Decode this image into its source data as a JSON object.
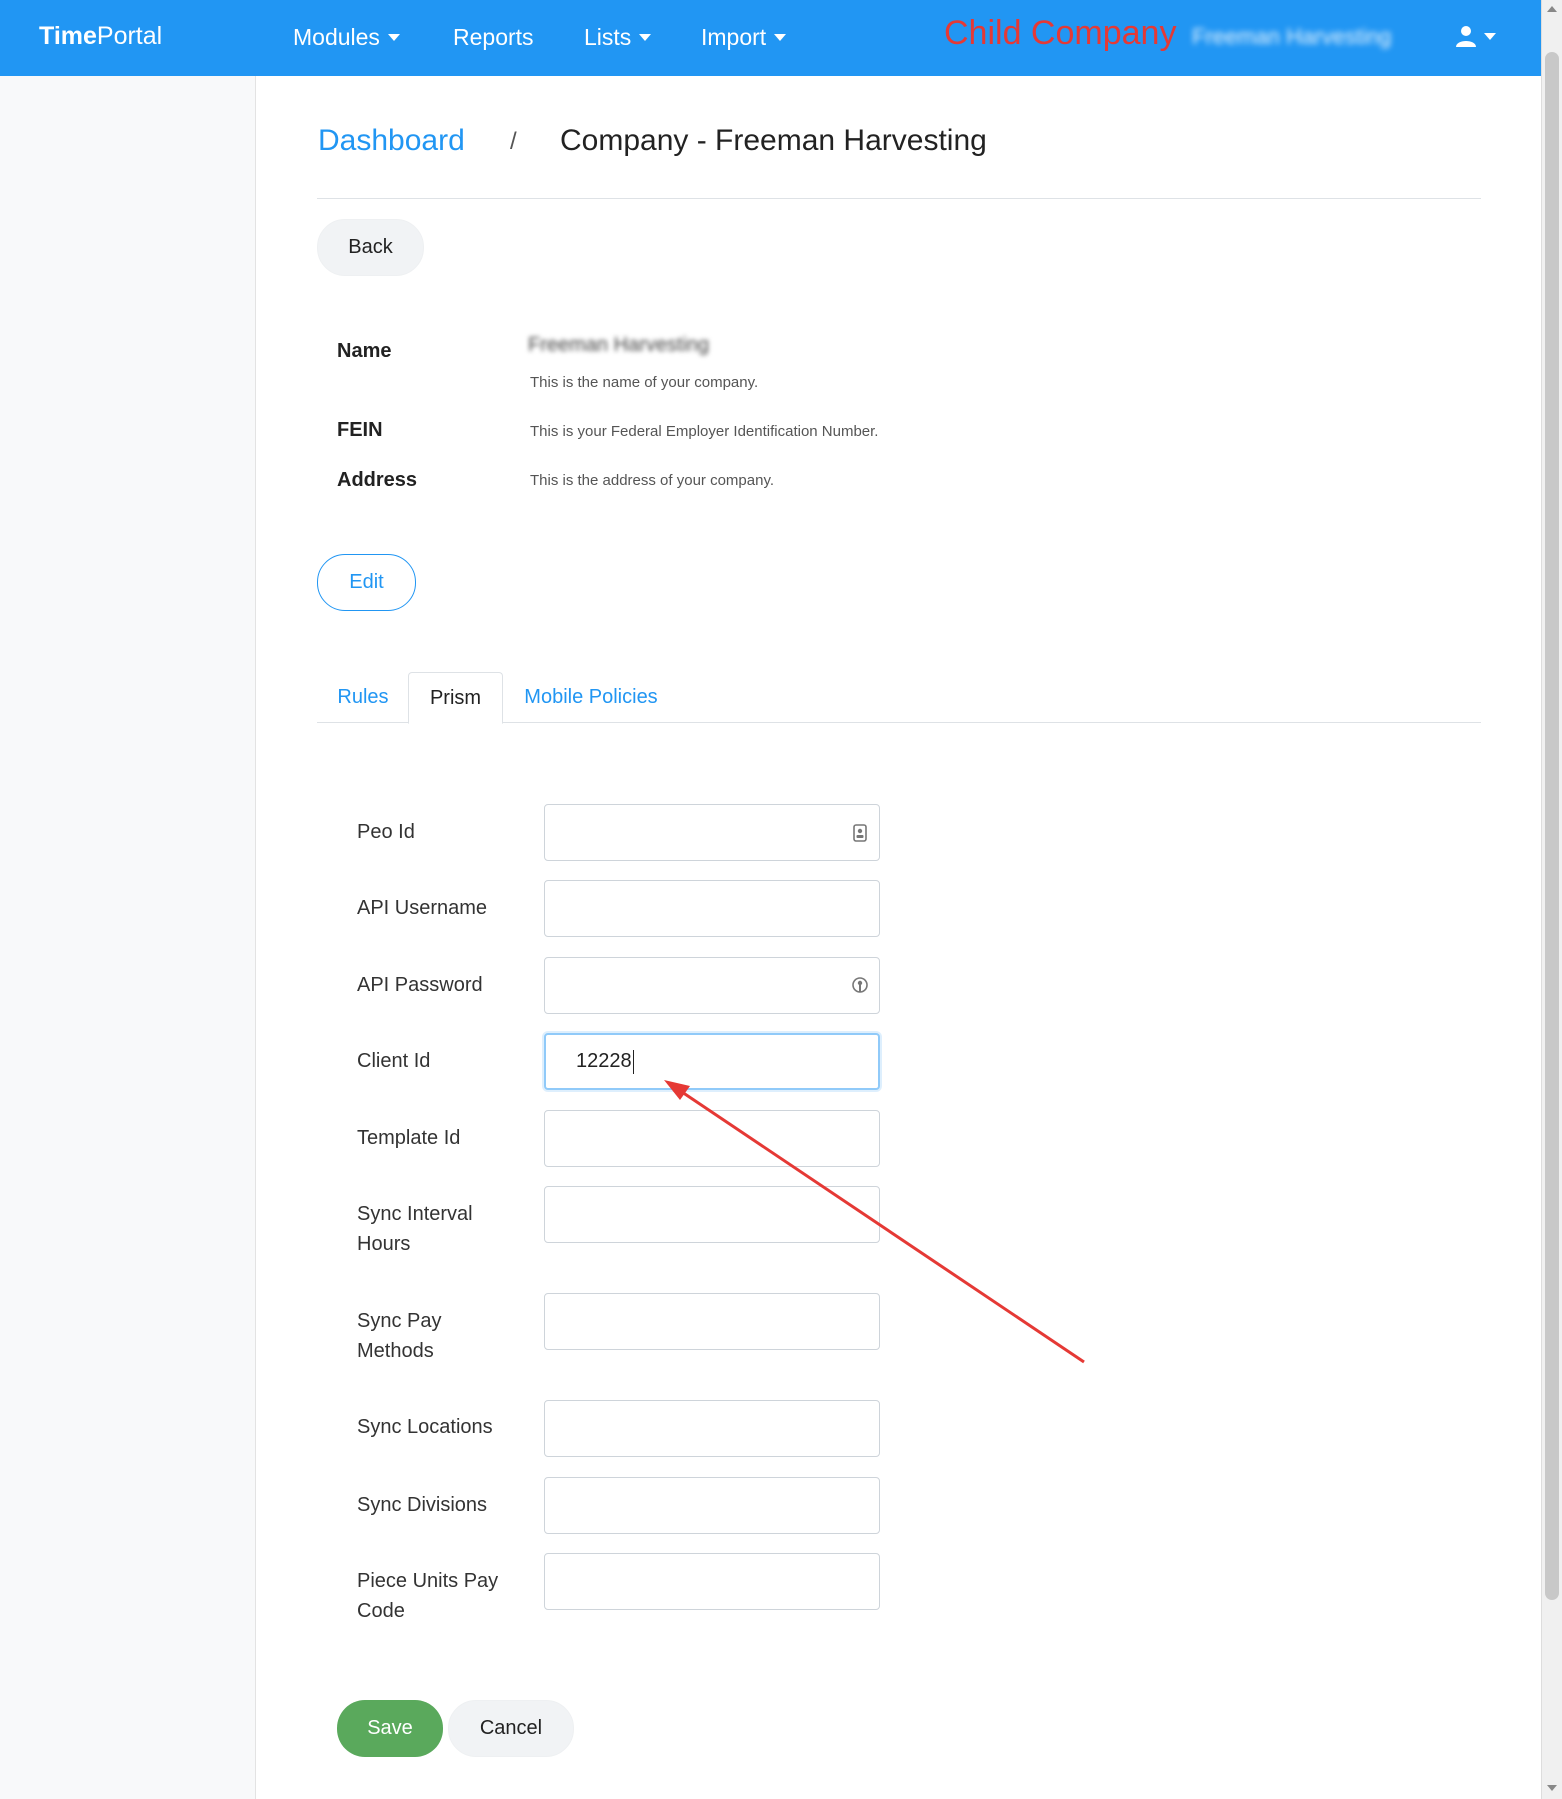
{
  "nav": {
    "brand_bold": "Time",
    "brand_rest": "Portal",
    "items": [
      {
        "label": "Modules",
        "has_caret": true
      },
      {
        "label": "Reports",
        "has_caret": false
      },
      {
        "label": "Lists",
        "has_caret": true
      },
      {
        "label": "Import",
        "has_caret": true
      }
    ],
    "annotation": "Child Company",
    "company_blurred": "Freeman Harvesting",
    "user_icon": "user-icon"
  },
  "breadcrumb": {
    "link": "Dashboard",
    "separator": "/",
    "current": "Company - Freeman Harvesting"
  },
  "buttons": {
    "back": "Back",
    "edit": "Edit",
    "save": "Save",
    "cancel": "Cancel"
  },
  "info": {
    "name_label": "Name",
    "name_value_blurred": "Freeman Harvesting",
    "name_help": "This is the name of your company.",
    "fein_label": "FEIN",
    "fein_help": "This is your Federal Employer Identification Number.",
    "address_label": "Address",
    "address_help": "This is the address of your company."
  },
  "tabs": {
    "rules": "Rules",
    "prism": "Prism",
    "mobile": "Mobile Policies",
    "active": "Prism"
  },
  "form": {
    "peo_id": {
      "label": "Peo Id",
      "value": ""
    },
    "api_username": {
      "label": "API Username",
      "value": ""
    },
    "api_password": {
      "label": "API Password",
      "value": ""
    },
    "client_id": {
      "label": "Client Id",
      "value": "12228"
    },
    "template_id": {
      "label": "Template Id",
      "value": ""
    },
    "sync_interval_hours": {
      "label": "Sync Interval Hours",
      "value": ""
    },
    "sync_pay_methods": {
      "label": "Sync Pay Methods",
      "value": ""
    },
    "sync_locations": {
      "label": "Sync Locations",
      "value": ""
    },
    "sync_divisions": {
      "label": "Sync Divisions",
      "value": ""
    },
    "piece_units_pay_code": {
      "label": "Piece Units Pay Code",
      "value": ""
    }
  },
  "colors": {
    "primary": "#2196f3",
    "save": "#5aa95c",
    "annotation": "#e53935"
  }
}
